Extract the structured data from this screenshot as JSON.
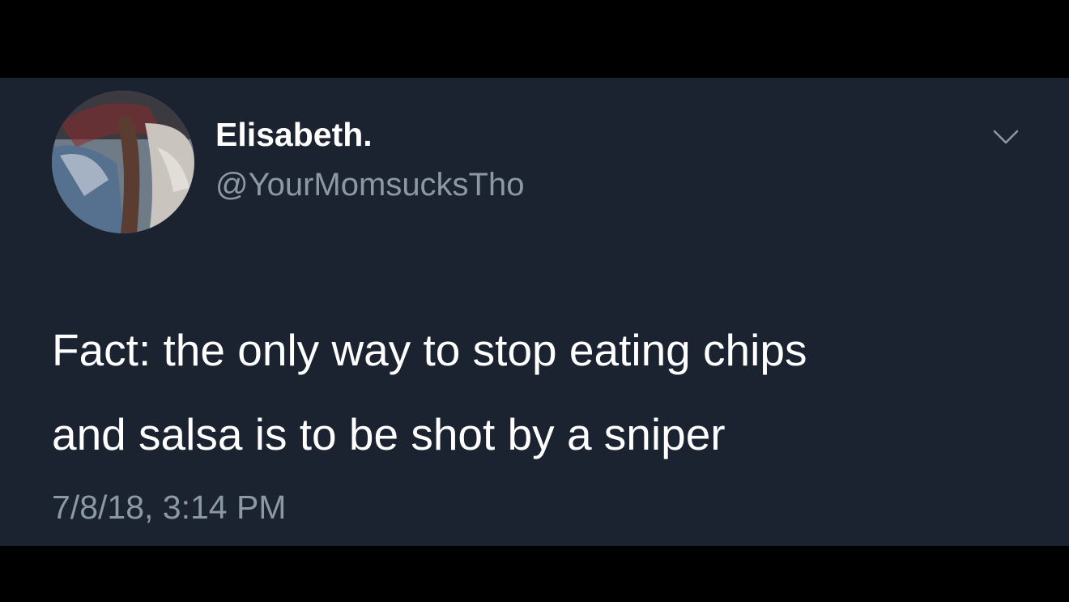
{
  "tweet": {
    "display_name": "Elisabeth.",
    "handle": "@YourMomsucksTho",
    "text_lines": [
      "Fact: the only way to stop eating chips",
      "and salsa is to be shot by a sniper"
    ],
    "timestamp": "7/8/18, 3:14 PM",
    "menu_icon": "chevron-down-icon",
    "avatar_icon": "avatar"
  },
  "colors": {
    "background": "#1b2331",
    "letterbox": "#000000",
    "primary_text": "#ffffff",
    "secondary_text": "#8b98a5"
  }
}
